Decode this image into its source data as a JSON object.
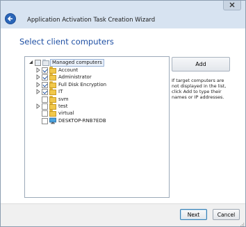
{
  "window": {
    "title": "Application Activation Task Creation Wizard"
  },
  "page": {
    "heading": "Select client computers"
  },
  "tree": {
    "root": {
      "label": "Managed computers",
      "checked": false
    },
    "items": [
      {
        "label": "Account",
        "checked": true,
        "expandable": true,
        "icon": "folder-icon"
      },
      {
        "label": "Administrator",
        "checked": true,
        "expandable": true,
        "icon": "folder-icon"
      },
      {
        "label": "Full Disk Encryption",
        "checked": true,
        "expandable": true,
        "icon": "folder-icon"
      },
      {
        "label": "IT",
        "checked": true,
        "expandable": true,
        "icon": "folder-icon"
      },
      {
        "label": "svm",
        "checked": false,
        "expandable": false,
        "icon": "folder-icon"
      },
      {
        "label": "test",
        "checked": false,
        "expandable": true,
        "icon": "folder-icon"
      },
      {
        "label": "virtual",
        "checked": false,
        "expandable": false,
        "icon": "folder-icon"
      },
      {
        "label": "DESKTOP-RNB7EDB",
        "checked": false,
        "expandable": false,
        "icon": "monitor-icon"
      }
    ]
  },
  "actions": {
    "add_label": "Add",
    "hint": "If target computers are not displayed in the list, click Add to type their names or IP addresses."
  },
  "footer": {
    "next_label": "Next",
    "cancel_label": "Cancel"
  },
  "colors": {
    "accent": "#1e4fa3",
    "titlebar": "#d7e3f1",
    "folder": "#f1c84b",
    "check": "#1b4e9c"
  }
}
